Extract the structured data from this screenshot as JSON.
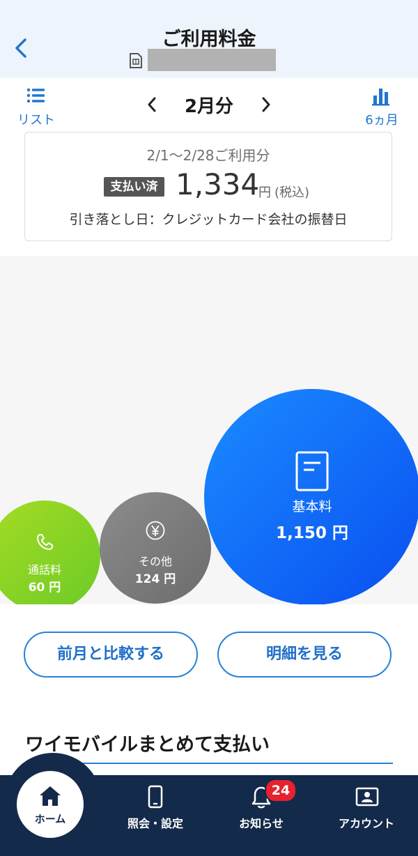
{
  "header": {
    "title": "ご利用料金"
  },
  "nav": {
    "list_label": "リスト",
    "month": "2月分",
    "six_month_label": "6ヵ月"
  },
  "summary": {
    "period": "2/1〜2/28ご利用分",
    "status": "支払い済",
    "amount": "1,334",
    "yen": "円",
    "tax_note": "(税込)",
    "debit_date": "引き落とし日：クレジットカード会社の振替日"
  },
  "breakdown": [
    {
      "label": "通話料",
      "value": "60 円",
      "amount": 60,
      "color": "#8fd425",
      "icon": "phone-icon"
    },
    {
      "label": "その他",
      "value": "124 円",
      "amount": 124,
      "color": "#7c7c7c",
      "icon": "yen-icon"
    },
    {
      "label": "基本料",
      "value": "1,150 円",
      "amount": 1150,
      "color": "#1473f5",
      "icon": "document-icon"
    }
  ],
  "actions": {
    "compare": "前月と比較する",
    "details": "明細を見る"
  },
  "section": {
    "title": "ワイモバイルまとめて支払い"
  },
  "bottom_nav": {
    "home": "ホーム",
    "settings": "照会・設定",
    "notices": "お知らせ",
    "notice_count": "24",
    "account": "アカウント"
  },
  "colors": {
    "accent": "#1f76d2",
    "nav_bg": "#142a4a",
    "badge": "#e8212e"
  }
}
